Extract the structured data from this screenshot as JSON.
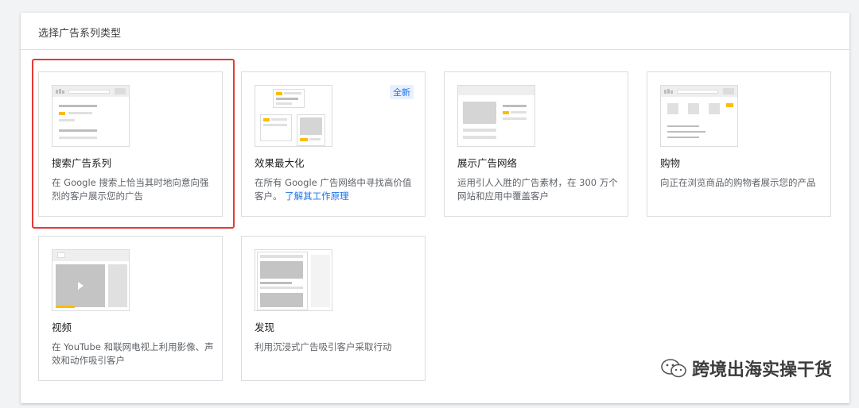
{
  "header": {
    "title": "选择广告系列类型"
  },
  "cards": [
    {
      "title": "搜索广告系列",
      "desc": "在 Google 搜索上恰当其时地向意向强烈的客户展示您的广告",
      "selected": true
    },
    {
      "title": "效果最大化",
      "desc": "在所有 Google 广告网络中寻找高价值客户。",
      "link": "了解其工作原理",
      "badge": "全新"
    },
    {
      "title": "展示广告网络",
      "desc": "运用引人入胜的广告素材，在 300 万个网站和应用中覆盖客户"
    },
    {
      "title": "购物",
      "desc": "向正在浏览商品的购物者展示您的产品"
    },
    {
      "title": "视频",
      "desc": "在 YouTube 和联网电视上利用影像、声效和动作吸引客户"
    },
    {
      "title": "发现",
      "desc": "利用沉浸式广告吸引客户采取行动"
    }
  ],
  "watermark": {
    "text": "跨境出海实操干货"
  },
  "colors": {
    "accent": "#1a73e8",
    "highlight": "#fbbc04",
    "selection": "#e53935"
  }
}
